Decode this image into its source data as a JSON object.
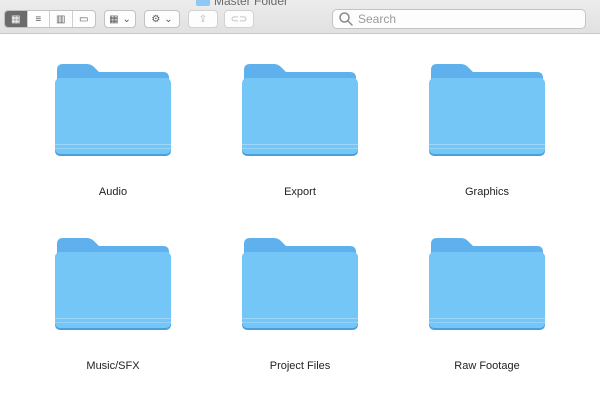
{
  "window": {
    "title": "Master Folder"
  },
  "toolbar": {
    "views": [
      {
        "name": "icon-view",
        "glyph": "▦"
      },
      {
        "name": "list-view",
        "glyph": "≡"
      },
      {
        "name": "column-view",
        "glyph": "▥"
      },
      {
        "name": "gallery-view",
        "glyph": "▭"
      }
    ],
    "group_glyph": "▦",
    "action_glyph": "⚙",
    "chevron": "⌄",
    "share_glyph": "⇪",
    "tag_glyph": "⊂⊃"
  },
  "search": {
    "placeholder": "Search",
    "value": ""
  },
  "colors": {
    "folder_front": "#74c6f7",
    "folder_back": "#5eb1ec",
    "folder_shadow": "#4a9ed9"
  },
  "folders": [
    {
      "label": "Audio"
    },
    {
      "label": "Export"
    },
    {
      "label": "Graphics"
    },
    {
      "label": "Music/SFX"
    },
    {
      "label": "Project Files"
    },
    {
      "label": "Raw Footage"
    }
  ]
}
